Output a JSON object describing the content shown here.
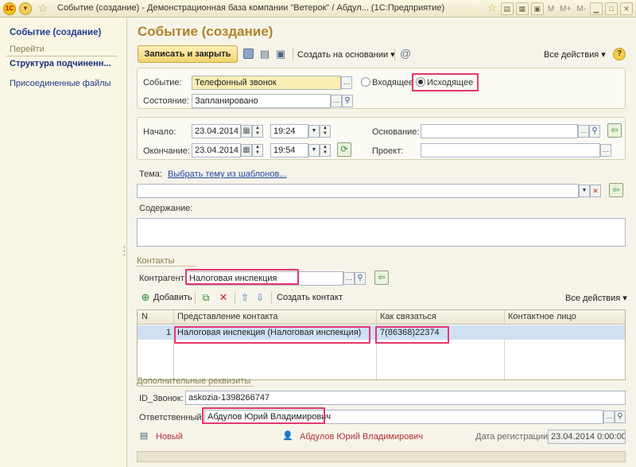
{
  "window": {
    "title": "Событие (создание) - Демонстрационная база компании \"Ветерок\" / Абдул... (1С:Предприятие)",
    "logo_text": "1С",
    "controls": [
      "M",
      "M+",
      "M-"
    ]
  },
  "sidebar": {
    "title": "Событие (создание)",
    "section": "Перейти",
    "items": [
      {
        "label": "Структура подчиненн..."
      },
      {
        "label": "Присоединенные файлы"
      }
    ]
  },
  "form": {
    "title": "Событие (создание)",
    "toolbar": {
      "primary": "Записать и закрыть",
      "create_based_on": "Создать на основании",
      "all_actions": "Все действия",
      "at_symbol": "@",
      "help": "?"
    },
    "event": {
      "label": "Событие:",
      "value": "Телефонный звонок",
      "incoming": "Входящее",
      "outgoing": "Исходящее",
      "selected": "outgoing"
    },
    "state": {
      "label": "Состояние:",
      "value": "Запланировано"
    },
    "start": {
      "label": "Начало:",
      "date": "23.04.2014",
      "time": "19:24"
    },
    "end": {
      "label": "Окончание:",
      "date": "23.04.2014",
      "time": "19:54"
    },
    "basis": {
      "label": "Основание:",
      "value": ""
    },
    "project": {
      "label": "Проект:",
      "value": ""
    },
    "topic": {
      "label": "Тема:",
      "template_link": "Выбрать тему из шаблонов...",
      "value": ""
    },
    "content": {
      "label": "Содержание:",
      "value": ""
    },
    "contacts": {
      "section": "Контакты",
      "counterparty_label": "Контрагент:",
      "counterparty": "Налоговая инспекция",
      "add": "Добавить",
      "create_contact": "Создать контакт",
      "all_actions": "Все действия",
      "columns": [
        "N",
        "Представление контакта",
        "Как связаться",
        "Контактное лицо"
      ],
      "rows": [
        {
          "n": "1",
          "presentation": "Налоговая инспекция (Налоговая инспекция)",
          "how": "7(86368)22374",
          "person": ""
        }
      ]
    },
    "extra": {
      "section": "Дополнительные реквизиты",
      "call_id_label": "ID_Звонок:",
      "call_id": "askozia-1398266747",
      "responsible_label": "Ответственный:",
      "responsible": "Абдулов Юрий Владимирович"
    },
    "footer": {
      "status": "Новый",
      "author": "Абдулов Юрий Владимирович",
      "reg_label": "Дата регистрации:",
      "reg_date": "23.04.2014  0:00:00"
    }
  },
  "colors": {
    "title": "#b3822a",
    "highlight": "#e6376e",
    "link": "#1d4aa8",
    "selected_row": "#cfe0f3"
  }
}
